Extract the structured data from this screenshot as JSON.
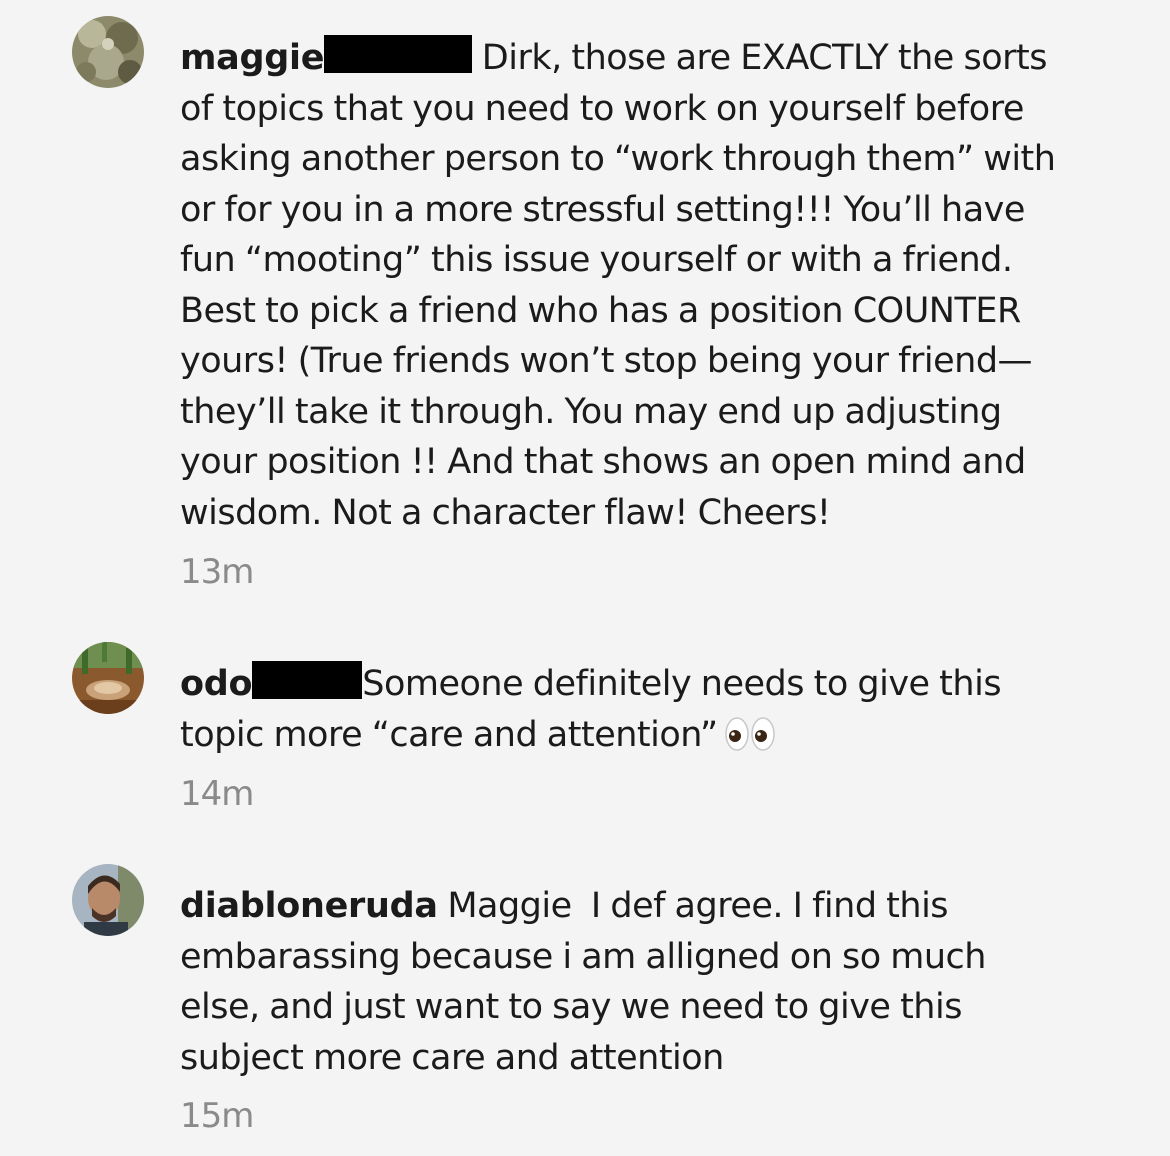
{
  "comments": [
    {
      "username": "maggie",
      "lines": [
        "Dirk, those are EXACTLY the sorts",
        "of topics that you need to work on yourself before",
        "asking another person to “work through them” with",
        "or for you in a more stressful setting!!! You’ll have",
        "fun “mooting” this issue yourself or with a friend.",
        "Best to pick a friend who has a position COUNTER",
        "yours! (True friends won’t stop being your friend—",
        "they’ll take it through. You may end up adjusting",
        "your position !! And that shows an open mind and",
        "wisdom. Not a character flaw! Cheers!"
      ],
      "time": "13m",
      "avatar_icon": "moss-photo-avatar-icon"
    },
    {
      "username": "odo",
      "lines": [
        "Someone definitely needs to give this",
        "topic more “care and attention”"
      ],
      "emoji_icon": "eyes-emoji-icon",
      "time": "14m",
      "avatar_icon": "cactus-photo-avatar-icon"
    },
    {
      "username": "diabloneruda",
      "lines": [
        "Maggie  I def agree. I find this",
        "embarassing because i am alligned on so much",
        "else, and just want to say we need to give this",
        "subject more care and attention"
      ],
      "time": "15m",
      "avatar_icon": "person-photo-avatar-icon"
    }
  ],
  "colors": {
    "background": "#f4f4f4",
    "text": "#1b1b1b",
    "timestamp": "#8a8a8a",
    "redaction": "#000000"
  }
}
